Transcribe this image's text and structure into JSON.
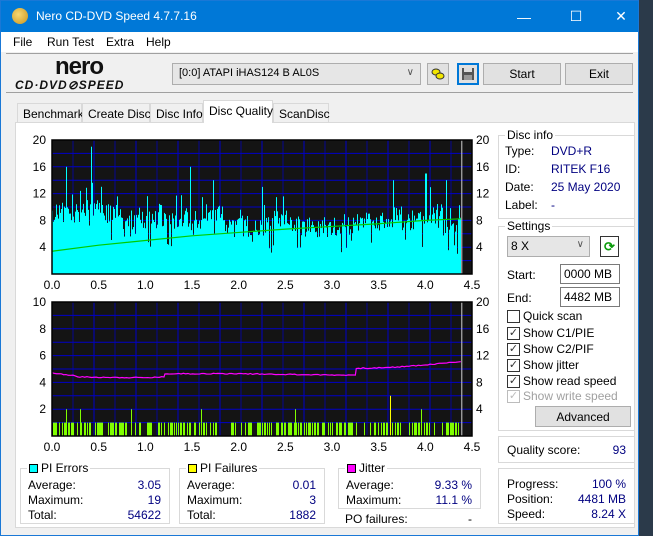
{
  "window": {
    "title": "Nero CD-DVD Speed 4.7.7.16",
    "minimize_glyph": "—",
    "maximize_glyph": "☐",
    "close_glyph": "✕"
  },
  "menu": [
    "File",
    "Run Test",
    "Extra",
    "Help"
  ],
  "toolbar": {
    "logo_top": "nero",
    "logo_bottom": "CD·DVD⊘SPEED",
    "drive": "[0:0]  ATAPI iHAS124   B AL0S",
    "start_label": "Start",
    "exit_label": "Exit"
  },
  "tabs": [
    "Benchmark",
    "Create Disc",
    "Disc Info",
    "Disc Quality",
    "ScanDisc"
  ],
  "active_tab": "Disc Quality",
  "disc_info": {
    "title": "Disc info",
    "type_label": "Type:",
    "type": "DVD+R",
    "id_label": "ID:",
    "id": "RITEK F16",
    "date_label": "Date:",
    "date": "25 May 2020",
    "label_label": "Label:",
    "label": "-"
  },
  "settings": {
    "title": "Settings",
    "speed": "8 X",
    "start_label": "Start:",
    "start": "0000 MB",
    "end_label": "End:",
    "end": "4482 MB",
    "quick_scan": {
      "label": "Quick scan",
      "checked": false
    },
    "show_c1": {
      "label": "Show C1/PIE",
      "checked": true
    },
    "show_c2": {
      "label": "Show C2/PIF",
      "checked": true
    },
    "show_jitter": {
      "label": "Show jitter",
      "checked": true
    },
    "show_read": {
      "label": "Show read speed",
      "checked": true
    },
    "show_write": {
      "label": "Show write speed",
      "checked": true,
      "disabled": true
    },
    "advanced_label": "Advanced"
  },
  "quality": {
    "label": "Quality score:",
    "value": "93"
  },
  "progress": {
    "progress_label": "Progress:",
    "progress": "100 %",
    "position_label": "Position:",
    "position": "4481 MB",
    "speed_label": "Speed:",
    "speed": "8.24 X"
  },
  "pi_errors": {
    "title": "PI Errors",
    "color": "#00ffff",
    "average_label": "Average:",
    "average": "3.05",
    "maximum_label": "Maximum:",
    "maximum": "19",
    "total_label": "Total:",
    "total": "54622"
  },
  "pi_failures": {
    "title": "PI Failures",
    "color": "#ffff00",
    "average_label": "Average:",
    "average": "0.01",
    "maximum_label": "Maximum:",
    "maximum": "3",
    "total_label": "Total:",
    "total": "1882"
  },
  "jitter": {
    "title": "Jitter",
    "color": "#ff00ff",
    "average_label": "Average:",
    "average": "9.33 %",
    "maximum_label": "Maximum:",
    "maximum": "11.1 %",
    "po_label": "PO failures:",
    "po": "-"
  },
  "chart_data": [
    {
      "type": "bar",
      "title": "PI Errors",
      "x_ticks": [
        "0.0",
        "0.5",
        "1.0",
        "1.5",
        "2.0",
        "2.5",
        "3.0",
        "3.5",
        "4.0",
        "4.5"
      ],
      "xlim": [
        0,
        4.5
      ],
      "y_left_ticks": [
        "20",
        "16",
        "12",
        "8",
        "4"
      ],
      "y_right_ticks": [
        "20",
        "16",
        "12",
        "8",
        "4"
      ],
      "ylim": [
        0,
        20
      ],
      "end_position": 4.38,
      "bar_color": "#00ffff",
      "series": [
        {
          "name": "PI Errors (max per sample)",
          "x_range": [
            0,
            4.38
          ],
          "baseline_level": [
            9,
            9,
            10,
            9,
            8,
            8,
            8,
            8,
            8,
            9,
            7,
            7,
            7,
            8,
            7,
            7,
            7,
            7,
            8,
            8,
            9,
            8,
            9,
            7
          ]
        },
        {
          "name": "Read speed",
          "color": "#00cc00",
          "x": [
            0,
            0.5,
            1.0,
            1.5,
            2.0,
            2.5,
            3.0,
            3.5,
            4.0,
            4.38
          ],
          "values": [
            3.4,
            4.3,
            5.0,
            5.7,
            6.2,
            6.7,
            7.1,
            7.5,
            8.0,
            8.24
          ]
        }
      ],
      "peaks": [
        [
          0.15,
          16
        ],
        [
          0.42,
          19
        ],
        [
          1.48,
          16
        ],
        [
          1.72,
          14
        ],
        [
          2.25,
          13
        ],
        [
          3.65,
          14
        ],
        [
          4.0,
          15
        ],
        [
          4.22,
          14
        ]
      ]
    },
    {
      "type": "bar",
      "title": "PI Failures / Jitter",
      "x_ticks": [
        "0.0",
        "0.5",
        "1.0",
        "1.5",
        "2.0",
        "2.5",
        "3.0",
        "3.5",
        "4.0",
        "4.5"
      ],
      "xlim": [
        0,
        4.5
      ],
      "y_left_ticks": [
        "10",
        "8",
        "6",
        "4",
        "2"
      ],
      "y_left_lim": [
        0,
        10
      ],
      "y_right_ticks": [
        "20",
        "16",
        "12",
        "8",
        "4"
      ],
      "y_right_lim": [
        0,
        20
      ],
      "end_position": 4.38,
      "bar_color": "#80ff00",
      "series": [
        {
          "name": "PI Failures",
          "peaks": [
            [
              0.05,
              2
            ],
            [
              0.15,
              2
            ],
            [
              0.3,
              2
            ],
            [
              0.85,
              2
            ],
            [
              1.42,
              2
            ],
            [
              1.6,
              2
            ],
            [
              2.6,
              2
            ],
            [
              3.5,
              2
            ],
            [
              3.62,
              3
            ],
            [
              3.65,
              3
            ],
            [
              3.95,
              2
            ],
            [
              4.2,
              2
            ]
          ]
        },
        {
          "name": "Jitter",
          "color": "#ff00ff",
          "x": [
            0,
            0.2,
            0.3,
            1.0,
            1.2,
            1.21,
            2.0,
            2.5,
            3.0,
            3.25,
            3.26,
            3.6,
            4.0,
            4.38
          ],
          "values": [
            9.4,
            9.1,
            8.8,
            8.7,
            8.8,
            9.3,
            9.3,
            9.2,
            9.1,
            9.1,
            10.1,
            10.2,
            10.6,
            11.1
          ]
        }
      ]
    }
  ]
}
